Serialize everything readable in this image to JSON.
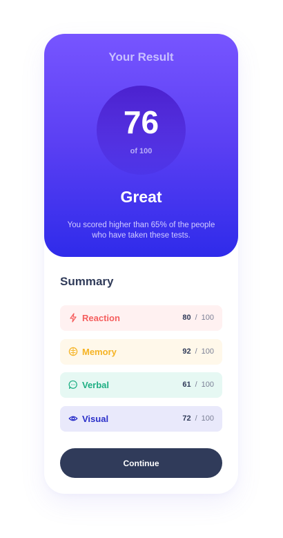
{
  "result": {
    "title": "Your Result",
    "score": "76",
    "score_of": "of 100",
    "rating": "Great",
    "description": "You scored higher than 65% of the people who have taken these tests."
  },
  "summary": {
    "title": "Summary",
    "items": [
      {
        "label": "Reaction",
        "score": "80",
        "separator": "/",
        "max": "100",
        "icon": "lightning-icon",
        "color": "#f55e5e",
        "bg": "#fff1f1"
      },
      {
        "label": "Memory",
        "score": "92",
        "separator": "/",
        "max": "100",
        "icon": "brain-icon",
        "color": "#f5b324",
        "bg": "#fff8ea"
      },
      {
        "label": "Verbal",
        "score": "61",
        "separator": "/",
        "max": "100",
        "icon": "chat-bubble-icon",
        "color": "#1eaf83",
        "bg": "#e6f8f3"
      },
      {
        "label": "Visual",
        "score": "72",
        "separator": "/",
        "max": "100",
        "icon": "eye-icon",
        "color": "#2a2fc9",
        "bg": "#e9e9fb"
      }
    ]
  },
  "continue_label": "Continue"
}
